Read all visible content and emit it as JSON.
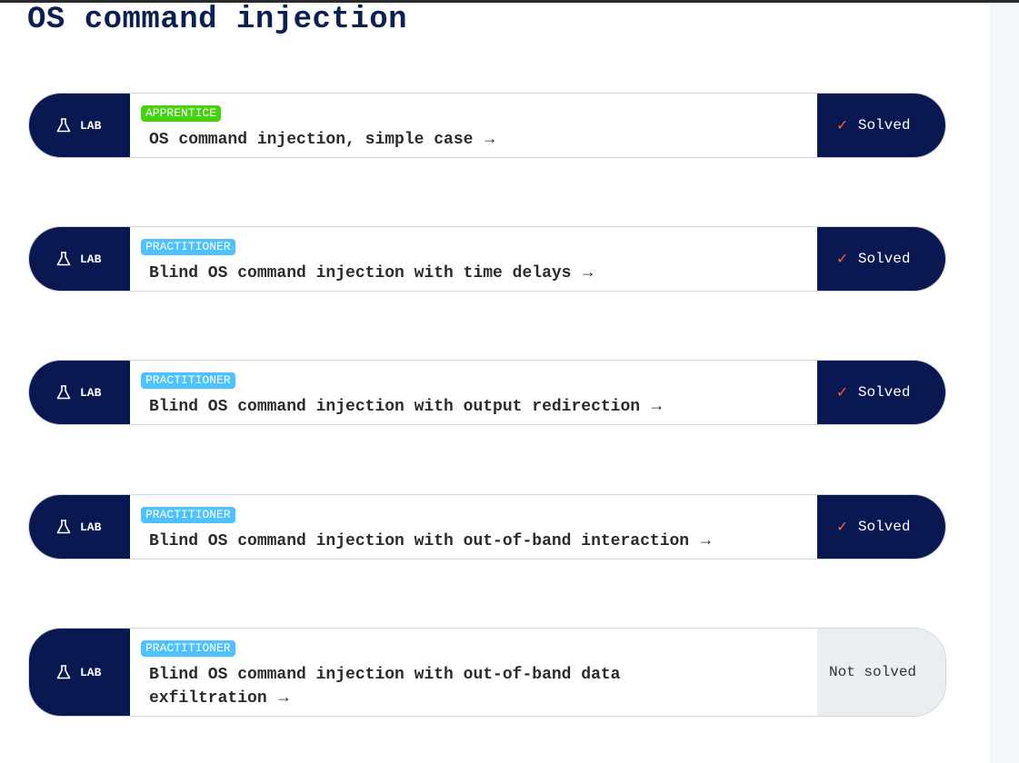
{
  "page": {
    "title": "OS command injection"
  },
  "labs": [
    {
      "tag": "LAB",
      "level": "APPRENTICE",
      "level_class": "apprentice",
      "title": "OS command injection, simple case",
      "status": "Solved"
    },
    {
      "tag": "LAB",
      "level": "PRACTITIONER",
      "level_class": "practitioner",
      "title": "Blind OS command injection with time delays",
      "status": "Solved"
    },
    {
      "tag": "LAB",
      "level": "PRACTITIONER",
      "level_class": "practitioner",
      "title": "Blind OS command injection with output redirection",
      "status": "Solved"
    },
    {
      "tag": "LAB",
      "level": "PRACTITIONER",
      "level_class": "practitioner",
      "title": "Blind OS command injection with out-of-band interaction",
      "status": "Solved"
    },
    {
      "tag": "LAB",
      "level": "PRACTITIONER",
      "level_class": "practitioner",
      "title_line1": "Blind OS command injection with out-of-band data",
      "title_line2": "exfiltration",
      "status": "Not solved"
    }
  ],
  "icons": {
    "lab": "flask-icon",
    "solved": "check-icon",
    "link": "arrow-right-icon"
  },
  "colors": {
    "navy": "#0a1852",
    "apprentice": "#47d20f",
    "practitioner": "#4dc2ff",
    "check": "#ff6633",
    "unsolved_bg": "#e9eef1"
  }
}
